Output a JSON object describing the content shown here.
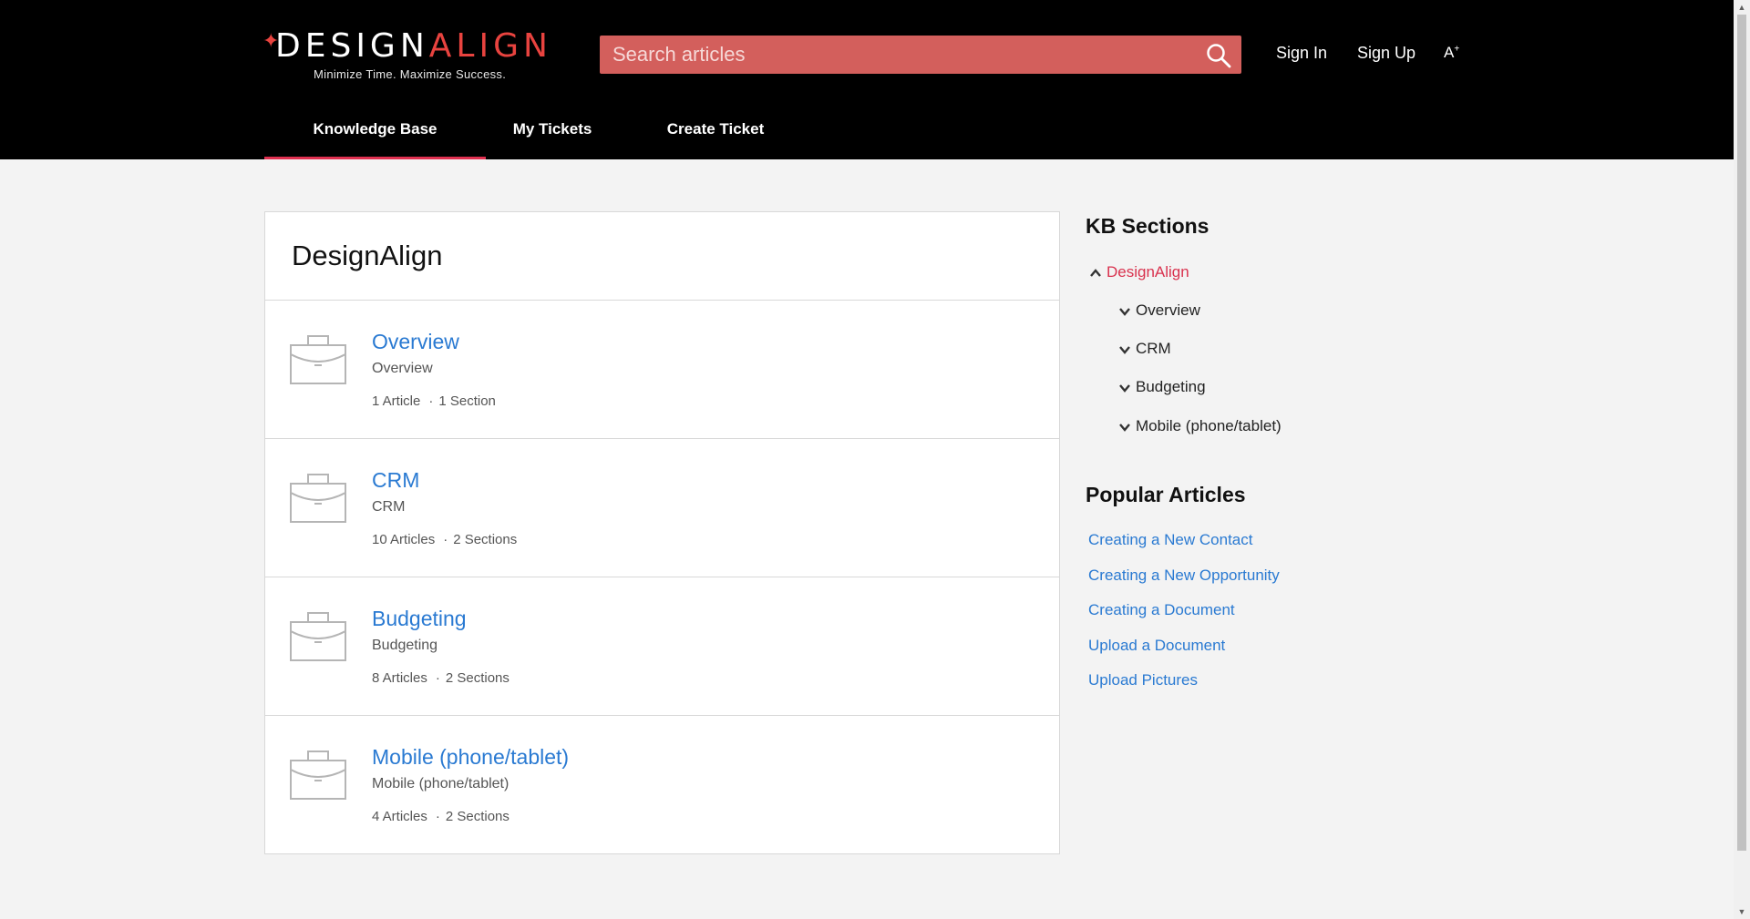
{
  "header": {
    "logo_part1": "DESIGN",
    "logo_part2": "ALIGN",
    "tagline": "Minimize Time. Maximize Success.",
    "search_placeholder": "Search articles",
    "sign_in": "Sign In",
    "sign_up": "Sign Up",
    "font_toggle": "A",
    "font_toggle_sup": "+"
  },
  "nav": {
    "tabs": [
      {
        "label": "Knowledge Base"
      },
      {
        "label": "My Tickets"
      },
      {
        "label": "Create Ticket"
      }
    ]
  },
  "main": {
    "title": "DesignAlign",
    "categories": [
      {
        "title": "Overview",
        "desc": "Overview",
        "articles": "1 Article",
        "sections": "1 Section"
      },
      {
        "title": "CRM",
        "desc": "CRM",
        "articles": "10 Articles",
        "sections": "2 Sections"
      },
      {
        "title": "Budgeting",
        "desc": "Budgeting",
        "articles": "8 Articles",
        "sections": "2 Sections"
      },
      {
        "title": "Mobile (phone/tablet)",
        "desc": "Mobile (phone/tablet)",
        "articles": "4 Articles",
        "sections": "2 Sections"
      }
    ],
    "meta_separator": "·"
  },
  "sidebar": {
    "kb_heading": "KB Sections",
    "root": "DesignAlign",
    "children": [
      "Overview",
      "CRM",
      "Budgeting",
      "Mobile (phone/tablet)"
    ],
    "popular_heading": "Popular Articles",
    "popular": [
      "Creating a New Contact",
      "Creating a New Opportunity",
      "Creating a Document",
      "Upload a Document",
      "Upload Pictures"
    ]
  },
  "colors": {
    "accent": "#e8433f",
    "link": "#2a7ad2",
    "active_root": "#d9324e",
    "search_bg": "#d35f5c"
  }
}
